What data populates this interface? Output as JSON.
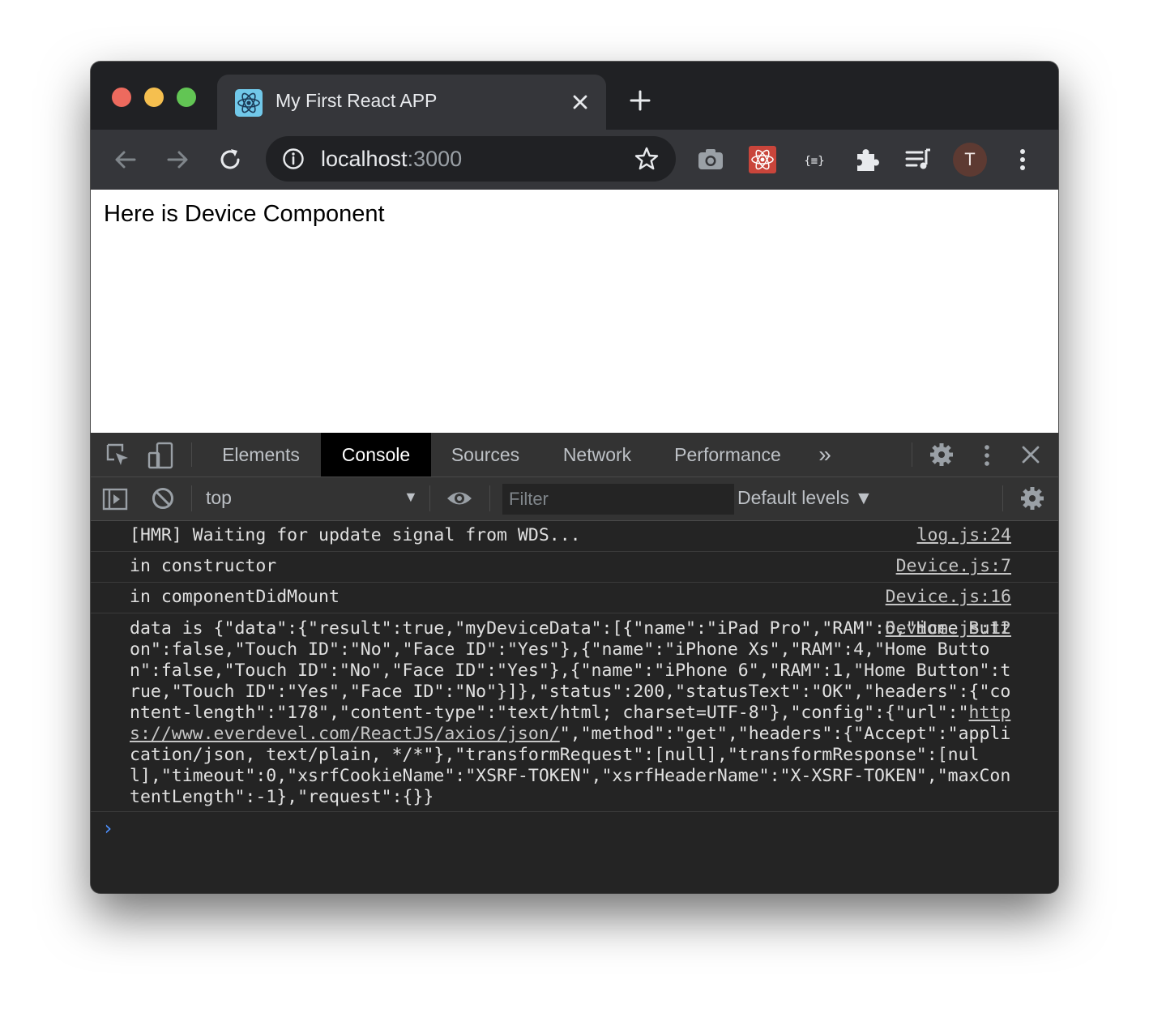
{
  "browser": {
    "tab": {
      "title": "My First React APP",
      "favicon": "react-logo-icon"
    },
    "address": {
      "host": "localhost",
      "port": ":3000"
    },
    "profile_initial": "T"
  },
  "page": {
    "text": "Here is Device Component"
  },
  "devtools": {
    "tabs": [
      {
        "label": "Elements"
      },
      {
        "label": "Console"
      },
      {
        "label": "Sources"
      },
      {
        "label": "Network"
      },
      {
        "label": "Performance"
      }
    ],
    "active_tab": "Console",
    "more_tabs_label": "»",
    "console": {
      "context": "top",
      "filter_placeholder": "Filter",
      "levels": "Default levels ▼",
      "logs": [
        {
          "message": "[HMR] Waiting for update signal from WDS...",
          "source": "log.js:24"
        },
        {
          "message": "in constructor",
          "source": "Device.js:7"
        },
        {
          "message": "in componentDidMount",
          "source": "Device.js:16"
        },
        {
          "message_start": "data is {\"data\":{\"result\":true,\"myDeviceData\":[{\"name\":\"iPad Pro\",\"RAM\":6,\"Home Button\":false,\"Touch ID\":\"No\",\"Face ID\":\"Yes\"},{\"name\":\"iPhone Xs\",\"RAM\":4,\"Home Button\":false,\"Touch ID\":\"No\",\"Face ID\":\"Yes\"},{\"name\":\"iPhone 6\",\"RAM\":1,\"Home Button\":true,\"Touch ID\":\"Yes\",\"Face ID\":\"No\"}]},\"status\":200,\"statusText\":\"OK\",\"headers\":{\"content-length\":\"178\",\"content-type\":\"text/html; charset=UTF-8\"},\"config\":{\"url\":\"",
          "link": "https://www.everdevel.com/ReactJS/axios/json/",
          "message_end": "\",\"method\":\"get\",\"headers\":{\"Accept\":\"application/json, text/plain, */*\"},\"transformRequest\":[null],\"transformResponse\":[null],\"timeout\":0,\"xsrfCookieName\":\"XSRF-TOKEN\",\"xsrfHeaderName\":\"X-XSRF-TOKEN\",\"maxContentLength\":-1},\"request\":{}}",
          "source": "Device.js:12"
        }
      ],
      "prompt": "›"
    }
  },
  "colors": {
    "accent": "#4d90fe",
    "active_tab_bg": "#000000"
  }
}
